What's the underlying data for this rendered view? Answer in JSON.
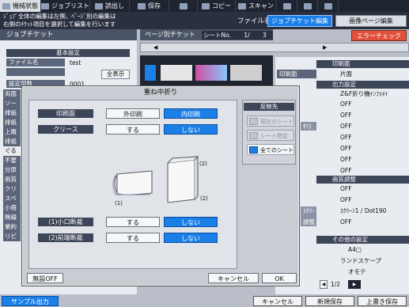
{
  "topbar": {
    "items": [
      {
        "label": "機械状態",
        "icon": "machine-icon"
      },
      {
        "label": "ジョブリスト",
        "icon": "list-icon"
      },
      {
        "label": "読出し",
        "icon": "folder-icon"
      },
      {
        "label": "保存",
        "icon": "save-icon"
      },
      {
        "label": "",
        "icon": "blank-icon"
      },
      {
        "label": "コピー",
        "icon": "copy-icon"
      },
      {
        "label": "スキャン",
        "icon": "scan-icon"
      },
      {
        "label": "",
        "icon": "gear-icon"
      },
      {
        "label": "",
        "icon": "volume-icon"
      },
      {
        "label": "",
        "icon": "help-icon"
      }
    ]
  },
  "header": {
    "message_line1": "ｼﾞｮﾌﾞ全体の編集は左側、ﾍﾟｰｼﾞ別の編集は",
    "message_line2": "右側のﾁｹｯﾄ項目を選択して編集を行います",
    "filename_label": "ファイル名：",
    "filename_value": "test",
    "tab_job_ticket_edit": "ジョブチケット編集",
    "tab_image_page_edit": "画像ページ編集"
  },
  "left": {
    "title": "ジョブチケット",
    "section_basic": "基本設定",
    "filename_label": "ファイル名",
    "filename_value": "test",
    "show_all_button": "全表示",
    "copies_label": "設定部数",
    "copies_value": "0001",
    "side_items": [
      "両面",
      "ソー",
      "排紙",
      "排紙",
      "上概",
      "排紙",
      "ぐる",
      "不要",
      "分原",
      "画質",
      "クリ",
      "スペ",
      "小冊",
      "無線",
      "業約",
      "リピ"
    ]
  },
  "middle": {
    "header": "ページ別チケット",
    "sheet_label": "シートNo.",
    "sheet_current": "1/",
    "sheet_total": "3",
    "error_check_button": "エラーチェック"
  },
  "right": {
    "section_print_side": "印刷面",
    "print_side_label": "印刷面",
    "print_side_value": "片面",
    "section_output": "出力設定",
    "output_values": [
      "Z&F折り機ｲﾝﾌｫﾒｲ",
      "OFF",
      "OFF",
      "OFF",
      "OFF",
      "OFF",
      "OFF",
      "OFF"
    ],
    "output_labels": [
      "",
      "",
      "",
      "",
      "ｾﾘ)",
      "",
      "",
      ""
    ],
    "section_quality": "画質調整",
    "quality_values": [
      "OFF",
      "OFF",
      "ｽｸﾘｰﾝ1 / Dot190",
      "OFF"
    ],
    "quality_labels": [
      "",
      "",
      "ｽｸﾘｰﾝ",
      "調整"
    ],
    "section_other": "その他の設定",
    "other_values": [
      "A4▢",
      "ランドスケープ",
      "オモテ"
    ],
    "pager_current": "1/2"
  },
  "dialog": {
    "title": "重ね中折り",
    "print_side_label": "印刷面",
    "outside_button": "外印刷",
    "inside_button": "内印刷",
    "crease_label": "クリース",
    "crease_yes": "する",
    "crease_no": "しない",
    "diagram_label_1": "(1)",
    "diagram_label_2a": "(2)",
    "diagram_label_2b": "(2)",
    "cut1_label": "(1)小口断裁",
    "cut1_yes": "する",
    "cut1_no": "しない",
    "cut2_label": "(2)前端断裁",
    "cut2_yes": "する",
    "cut2_no": "しない",
    "apply_title": "反映先",
    "apply_options": [
      "現在のシート",
      "シート指定",
      "全てのシート"
    ],
    "disable_button": "無設OFF",
    "cancel_button": "キャンセル",
    "ok_button": "OK"
  },
  "footer": {
    "sample_button": "サンプル出力",
    "cancel_button": "キャンセル",
    "save_new_button": "新規保存",
    "overwrite_button": "上書き保存"
  },
  "colors": {
    "accent_blue": "#1b7fe8",
    "error_red": "#e0503a",
    "dark_navy": "#1e2430"
  }
}
